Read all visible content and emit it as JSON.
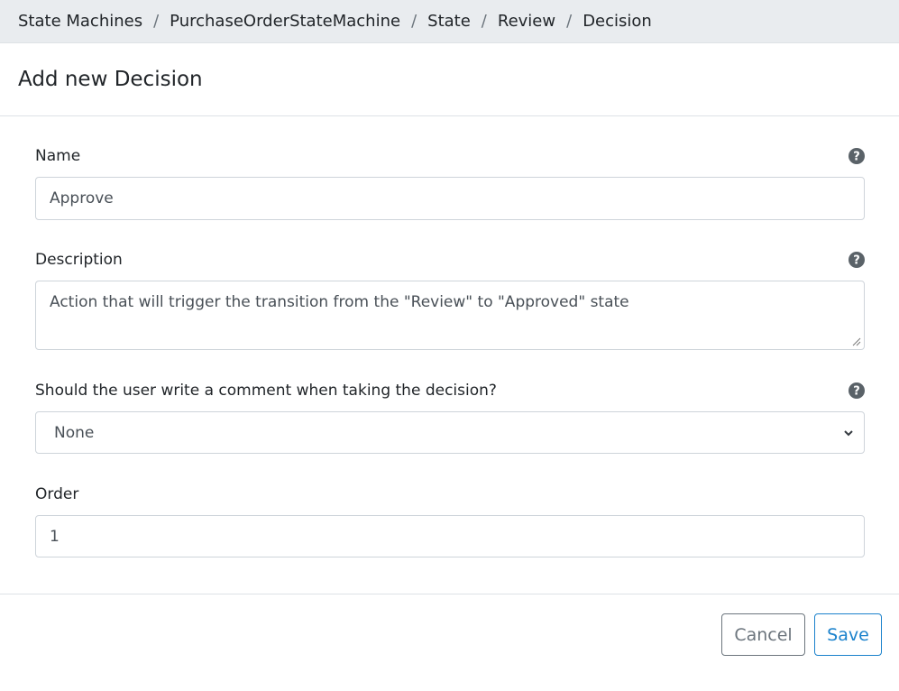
{
  "breadcrumb": {
    "items": [
      "State Machines",
      "PurchaseOrderStateMachine",
      "State",
      "Review",
      "Decision"
    ],
    "separator": "/"
  },
  "header": {
    "title": "Add new Decision"
  },
  "form": {
    "name": {
      "label": "Name",
      "value": "Approve"
    },
    "description": {
      "label": "Description",
      "value": "Action that will trigger the transition from the \"Review\" to \"Approved\" state"
    },
    "comment": {
      "label": "Should the user write a comment when taking the decision?",
      "selected": "None"
    },
    "order": {
      "label": "Order",
      "value": "1"
    }
  },
  "footer": {
    "cancel_label": "Cancel",
    "save_label": "Save"
  },
  "colors": {
    "primary": "#1b82cc",
    "secondary": "#6c757d",
    "help_icon": "#5a6268",
    "breadcrumb_bg": "#e9ecef"
  },
  "icons": {
    "help": "question-circle-icon",
    "select_arrow": "chevron-down-icon",
    "resize": "resize-grip-icon"
  }
}
